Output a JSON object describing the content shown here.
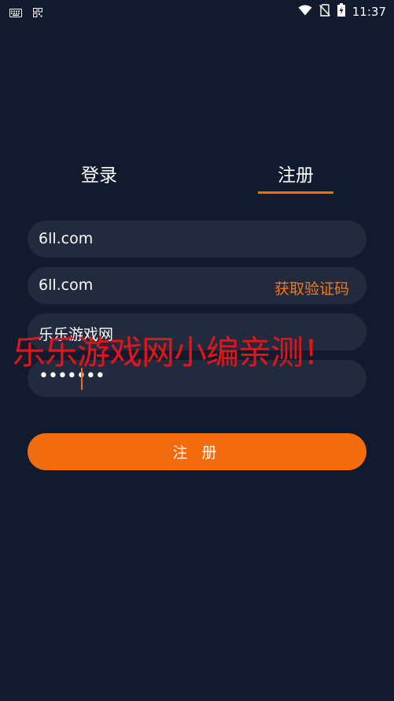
{
  "status_bar": {
    "time": "11:37",
    "icons": [
      "keyboard-icon",
      "qr-code-icon",
      "wifi-icon",
      "no-sim-icon",
      "battery-charging-icon"
    ]
  },
  "tabs": {
    "login": "登录",
    "register": "注册",
    "active": "register",
    "accent_color": "#f26b14"
  },
  "form": {
    "account_value": "6ll.com",
    "phone_value": "6ll.com",
    "get_code_label": "获取验证码",
    "nickname_value": "乐乐游戏网",
    "password_mask": "•••••••"
  },
  "submit_label": "注 册",
  "watermark": "乐乐游戏网小编亲测！",
  "colors": {
    "background": "#121a2d",
    "field": "#222b3e",
    "accent": "#f26b0f",
    "watermark": "#e3141a"
  }
}
